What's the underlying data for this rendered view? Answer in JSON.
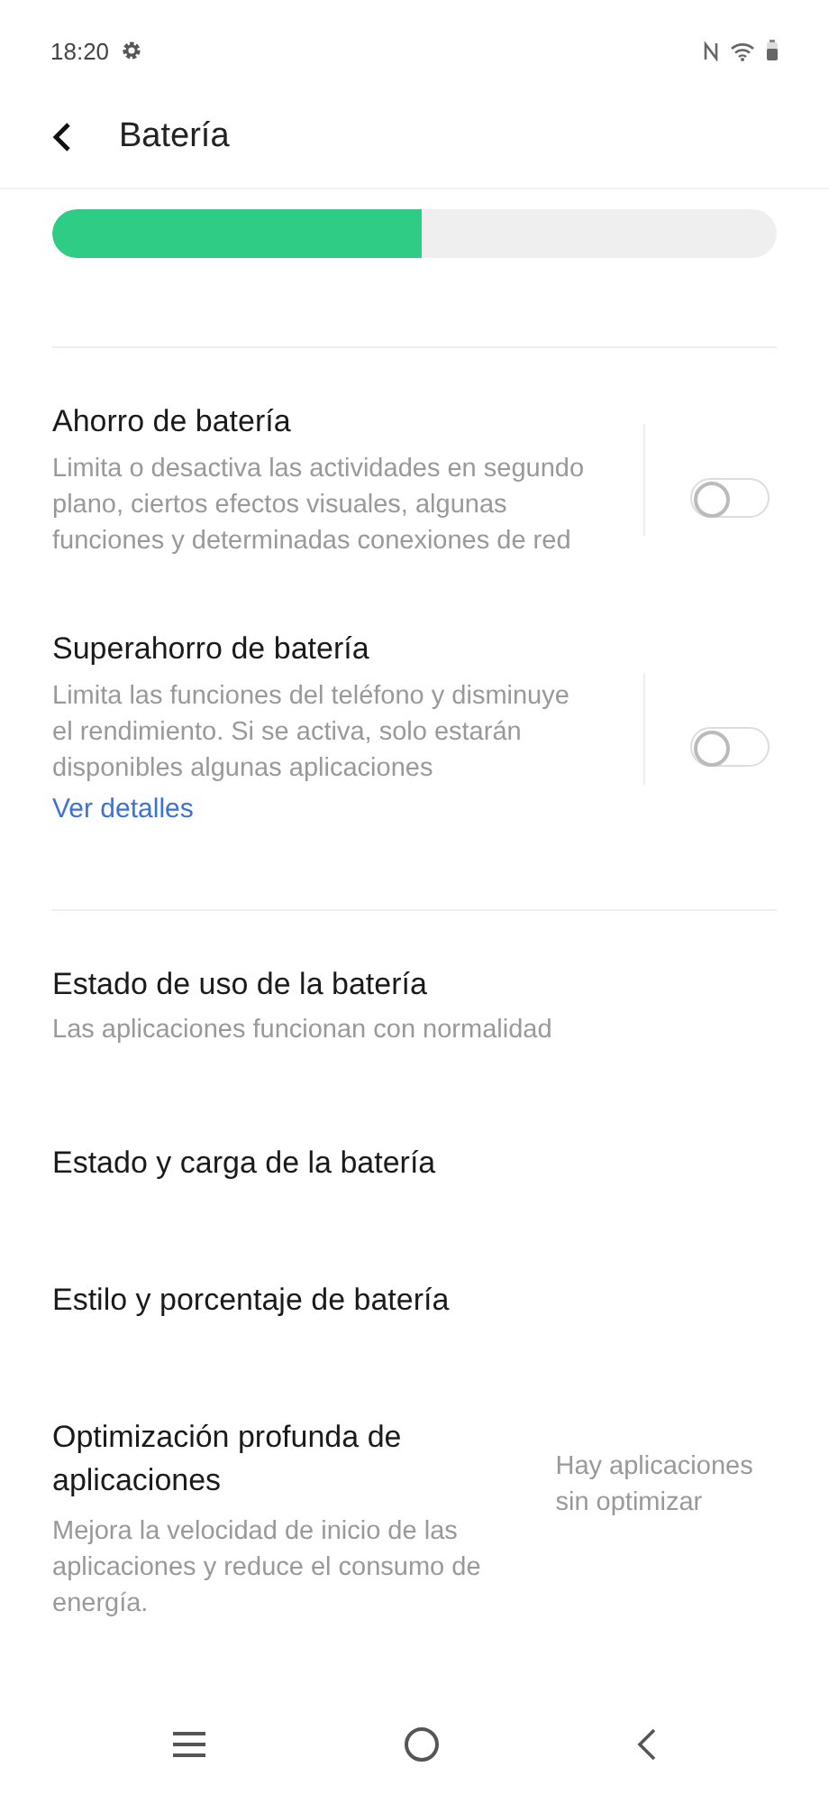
{
  "status_bar": {
    "time": "18:20"
  },
  "header": {
    "title": "Batería"
  },
  "battery_bar": {
    "level": 0.51
  },
  "sections": [
    {
      "items": [
        {
          "kind": "toggle",
          "title": "Ahorro de batería",
          "description": "Limita o desactiva las actividades en segundo plano, ciertos efectos visuales, algunas funciones y determinadas conexiones de red",
          "on": false
        },
        {
          "kind": "toggle",
          "title": "Superahorro de batería",
          "description": "Limita las funciones del teléfono y disminuye el rendimiento. Si se activa, solo estarán disponibles algunas aplicaciones",
          "link": "Ver detalles",
          "on": false
        }
      ]
    },
    {
      "items": [
        {
          "kind": "nav",
          "title": "Estado de uso de la batería",
          "description": "Las aplicaciones funcionan con normalidad"
        },
        {
          "kind": "nav",
          "title": "Estado y carga de la batería"
        },
        {
          "kind": "nav",
          "title": "Estilo y porcentaje de batería"
        },
        {
          "kind": "nav_value",
          "title": "Optimización profunda de aplicaciones",
          "description": "Mejora la velocidad de inicio de las aplicaciones y reduce el consumo de energía.",
          "value": "Hay aplicaciones sin optimizar"
        }
      ]
    }
  ]
}
